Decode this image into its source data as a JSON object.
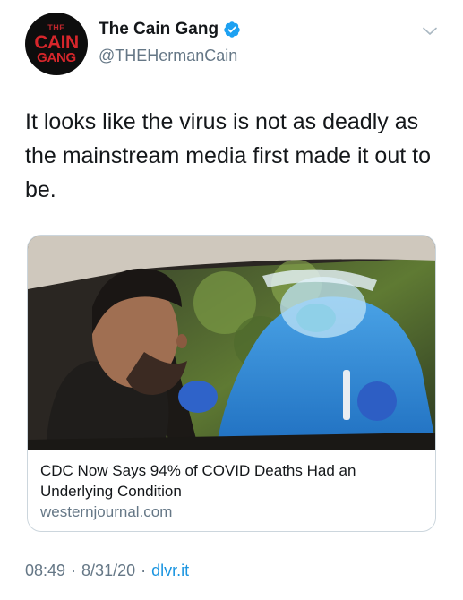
{
  "author": {
    "display_name": "The Cain Gang",
    "handle": "@THEHermanCain",
    "avatar_logo": {
      "line1": "THE",
      "line2": "CAIN",
      "line3": "GANG"
    }
  },
  "tweet": {
    "text": "It looks like the virus is not as deadly as the mainstream media first made it out to be."
  },
  "card": {
    "title": "CDC Now Says 94% of COVID Deaths Had an Underlying Condition",
    "domain": "westernjournal.com"
  },
  "meta": {
    "time": "08:49",
    "date": "8/31/20",
    "source": "dlvr.it",
    "separator": "·"
  },
  "colors": {
    "text": "#14171a",
    "secondary": "#657786",
    "link": "#1b95e0",
    "verified": "#1da1f2",
    "avatar_red": "#d6262b"
  },
  "icons": [
    "verified-badge-icon",
    "chevron-down-icon"
  ]
}
